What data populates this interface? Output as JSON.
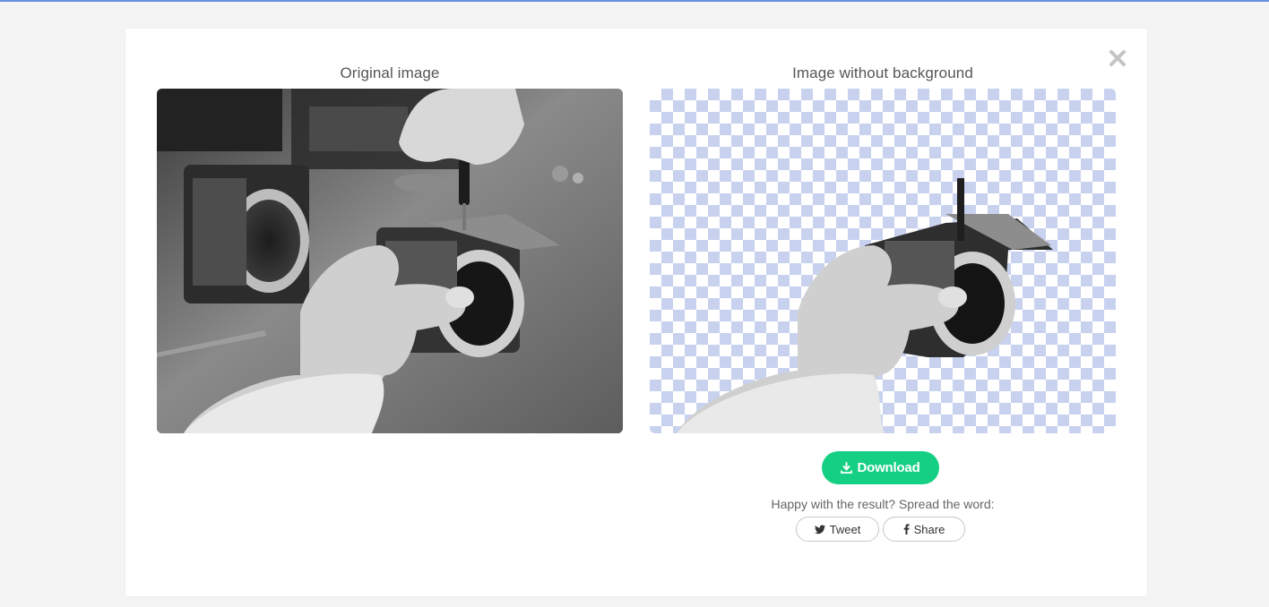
{
  "modal": {
    "left_title": "Original image",
    "right_title": "Image without background",
    "download_label": "Download",
    "share_prompt": "Happy with the result? Spread the word:",
    "tweet_label": "Tweet",
    "share_label": "Share"
  },
  "icons": {
    "close": "close-icon",
    "download": "download-icon",
    "twitter": "twitter-icon",
    "facebook": "facebook-icon"
  },
  "colors": {
    "accent_green": "#15cf84",
    "checker_blue": "#c8d2ee",
    "top_line": "#6d8fe0",
    "background": "#f4f4f5"
  }
}
